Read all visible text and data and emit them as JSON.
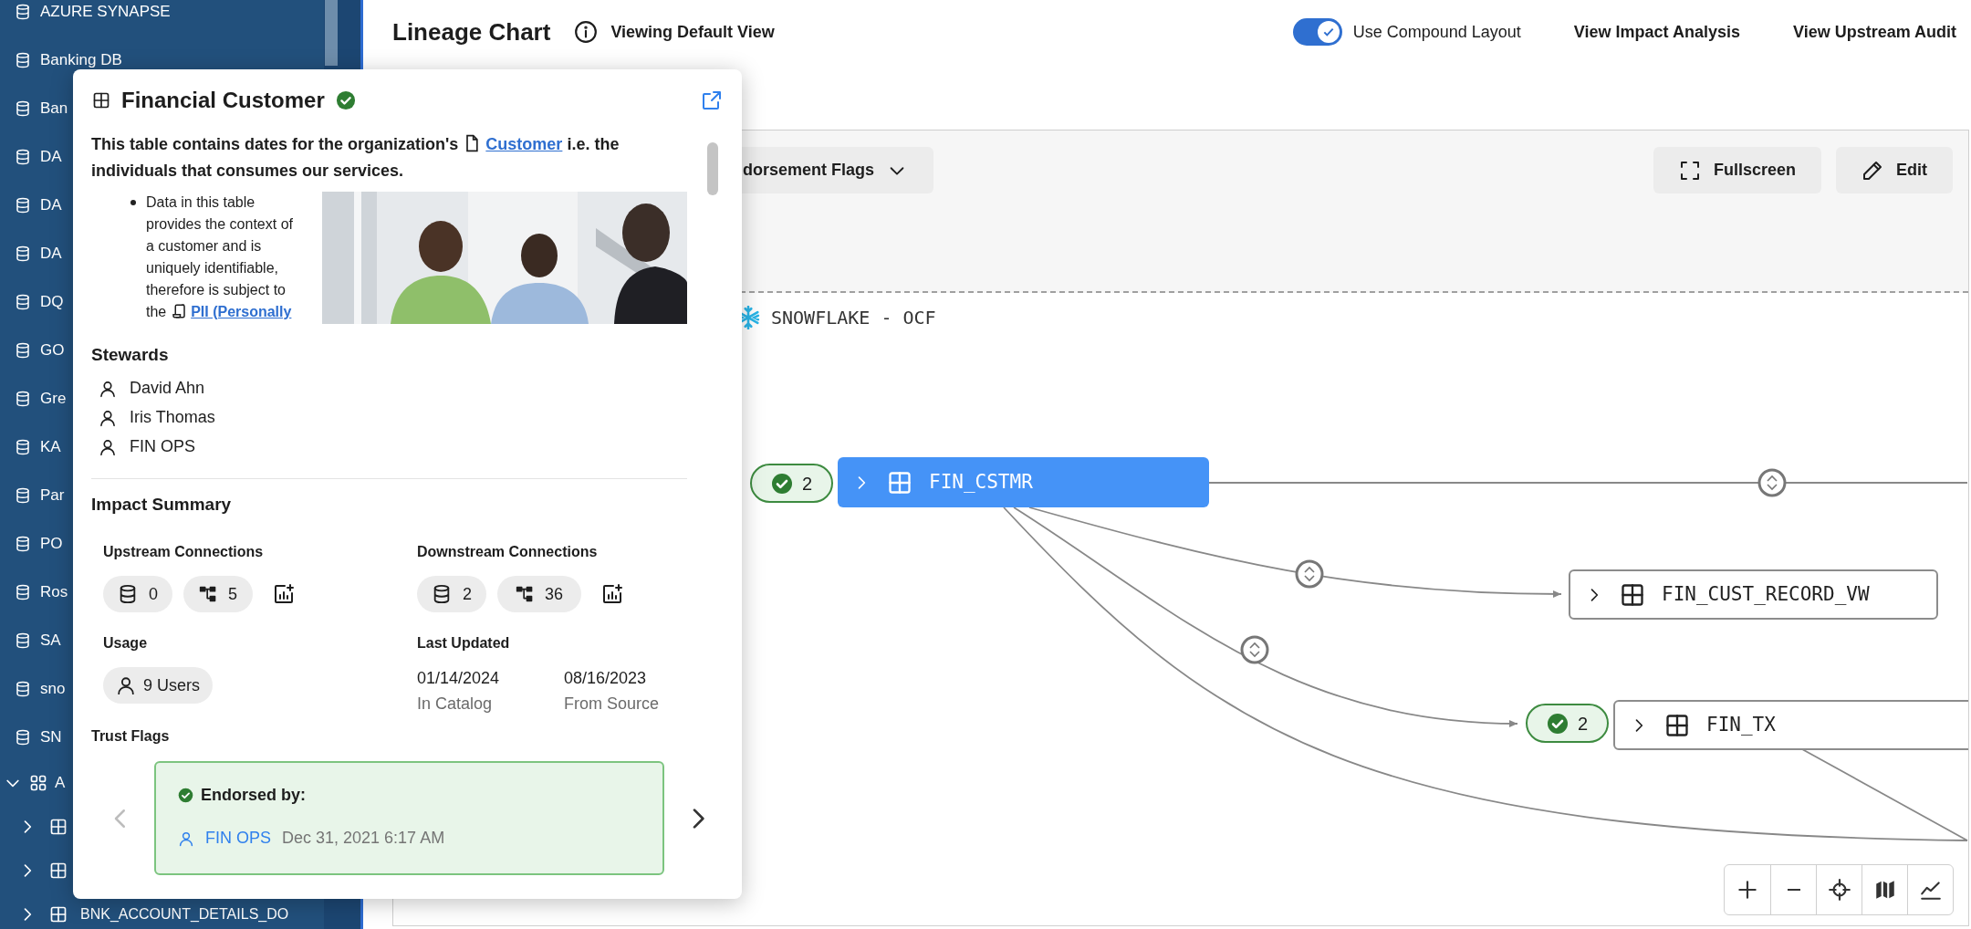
{
  "sidebar": {
    "items": [
      {
        "kind": "database",
        "label": "AZURE SYNAPSE"
      },
      {
        "kind": "database",
        "label": "Banking DB"
      },
      {
        "kind": "database",
        "label": "Ban"
      },
      {
        "kind": "database",
        "label": "DA"
      },
      {
        "kind": "database",
        "label": "DA"
      },
      {
        "kind": "database",
        "label": "DA"
      },
      {
        "kind": "database",
        "label": "DQ"
      },
      {
        "kind": "database",
        "label": "GO"
      },
      {
        "kind": "database",
        "label": "Gre"
      },
      {
        "kind": "database",
        "label": "KA"
      },
      {
        "kind": "database",
        "label": "Par"
      },
      {
        "kind": "database",
        "label": "PO"
      },
      {
        "kind": "database",
        "label": "Ros"
      },
      {
        "kind": "database",
        "label": "SA"
      },
      {
        "kind": "database",
        "label": "sno"
      },
      {
        "kind": "database",
        "label": "SN"
      },
      {
        "kind": "group",
        "label": "A",
        "expanded": true,
        "children": [
          {
            "kind": "table",
            "expanded": false
          },
          {
            "kind": "table",
            "expanded": false
          },
          {
            "kind": "table",
            "expanded": false,
            "label": "BNK_ACCOUNT_DETAILS_DO"
          }
        ]
      }
    ]
  },
  "header": {
    "title": "Lineage Chart",
    "view": "Viewing Default View",
    "compound_layout": {
      "label": "Use Compound Layout",
      "on": true
    },
    "links": [
      "View Impact Analysis",
      "View Upstream Audit"
    ]
  },
  "canvas": {
    "filter": "dorsement Flags",
    "buttons": [
      {
        "kind": "fullscreen",
        "label": "Fullscreen"
      },
      {
        "kind": "edit",
        "label": "Edit"
      }
    ],
    "group": "SNOWFLAKE - OCF",
    "nodes": [
      {
        "label": "FIN_CSTMR",
        "selected": true,
        "badge": "2"
      },
      {
        "label": "FIN_CUST_RECORD_VW",
        "selected": false
      },
      {
        "label": "FIN_TX",
        "selected": false,
        "badge": "2"
      }
    ]
  },
  "popover": {
    "title": "Financial Customer",
    "verified": true,
    "description": "This table contains dates for the organization's",
    "description_link": "Customer",
    "description_end": "i.e. the individuals that consumes our services.",
    "bullet": "Data in this table provides the context of a customer and is uniquely identifiable, therefore is subject to the",
    "bullet_link": "PII (Personally",
    "stewards": {
      "label": "Stewards",
      "names": [
        "David Ahn",
        "Iris Thomas",
        "FIN OPS"
      ]
    },
    "impact": {
      "label": "Impact Summary",
      "upstream": {
        "label": "Upstream Connections",
        "datasets": "0",
        "jobs": "5"
      },
      "downstream": {
        "label": "Downstream Connections",
        "datasets": "2",
        "jobs": "36"
      }
    },
    "usage": {
      "label": "Usage",
      "value": "9 Users"
    },
    "last_updated": {
      "label": "Last Updated",
      "entries": [
        {
          "date": "01/14/2024",
          "caption": "In Catalog"
        },
        {
          "date": "08/16/2023",
          "caption": "From Source"
        }
      ]
    },
    "trust_flags": {
      "label": "Trust Flags",
      "prev_enabled": false,
      "next_enabled": true,
      "cards": [
        {
          "title": "Endorsed by:",
          "user": "FIN OPS",
          "time": "Dec 31, 2021 6:17 AM"
        }
      ]
    }
  }
}
